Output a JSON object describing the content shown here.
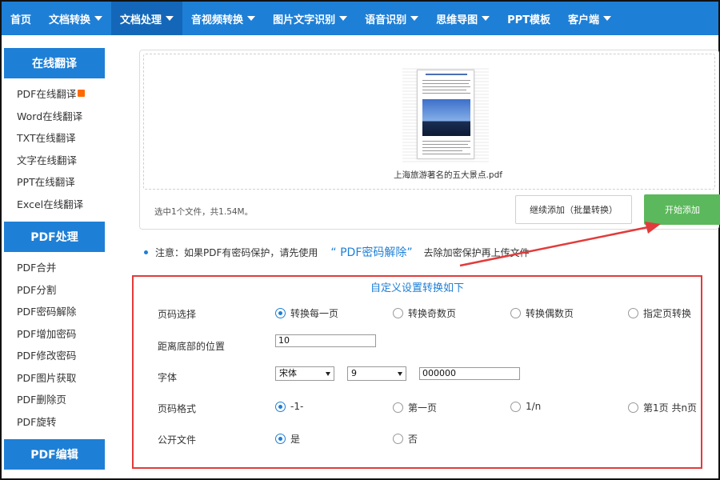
{
  "topnav": {
    "items": [
      {
        "label": "首页",
        "dropdown": false,
        "active": false
      },
      {
        "label": "文档转换",
        "dropdown": true,
        "active": false
      },
      {
        "label": "文档处理",
        "dropdown": true,
        "active": true
      },
      {
        "label": "音视频转换",
        "dropdown": true,
        "active": false
      },
      {
        "label": "图片文字识别",
        "dropdown": true,
        "active": false
      },
      {
        "label": "语音识别",
        "dropdown": true,
        "active": false
      },
      {
        "label": "思维导图",
        "dropdown": true,
        "active": false
      },
      {
        "label": "PPT模板",
        "dropdown": false,
        "active": false
      },
      {
        "label": "客户端",
        "dropdown": true,
        "active": false
      }
    ]
  },
  "sidebar": {
    "sections": [
      {
        "title": "在线翻译",
        "items": [
          "PDF在线翻译",
          "Word在线翻译",
          "TXT在线翻译",
          "文字在线翻译",
          "PPT在线翻译",
          "Excel在线翻译"
        ]
      },
      {
        "title": "PDF处理",
        "items": [
          "PDF合并",
          "PDF分割",
          "PDF密码解除",
          "PDF增加密码",
          "PDF修改密码",
          "PDF图片获取",
          "PDF删除页",
          "PDF旋转"
        ]
      },
      {
        "title": "PDF编辑",
        "items": []
      }
    ]
  },
  "upload": {
    "file_name": "上海旅游著名的五大景点.pdf",
    "status": "选中1个文件，共1.54M。",
    "continue_label": "继续添加（批量转换）",
    "start_label": "开始添加"
  },
  "note": {
    "prefix": "注意：如果PDF有密码保护，请先使用",
    "link": "“ PDF密码解除”",
    "suffix": "去除加密保护再上传文件"
  },
  "settings": {
    "title": "自定义设置转换如下",
    "page_select": {
      "label": "页码选择",
      "options": [
        "转换每一页",
        "转换奇数页",
        "转换偶数页",
        "指定页转换"
      ],
      "selected": 0
    },
    "bottom_position": {
      "label": "距离底部的位置",
      "value": "10"
    },
    "font": {
      "label": "字体",
      "family": "宋体",
      "size": "9",
      "color": "000000"
    },
    "page_format": {
      "label": "页码格式",
      "options": [
        "-1-",
        "第一页",
        "1/n",
        "第1页 共n页"
      ],
      "selected": 0
    },
    "public_file": {
      "label": "公开文件",
      "options": [
        "是",
        "否"
      ],
      "selected": 0
    }
  },
  "colors": {
    "brand": "#1e7fd6",
    "start_button": "#5cb85c",
    "highlight": "#e23b3b"
  }
}
